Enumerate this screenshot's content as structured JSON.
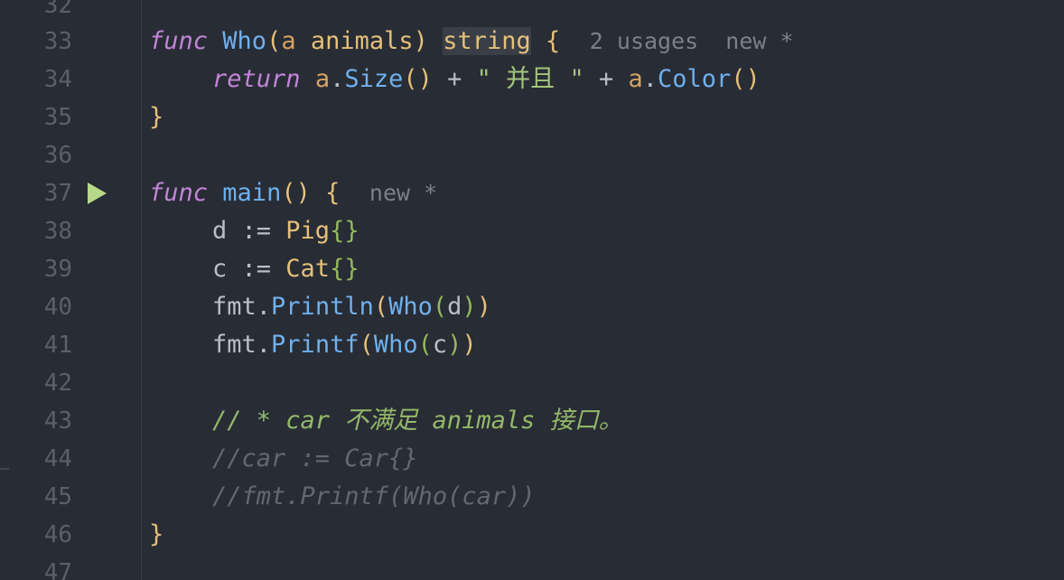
{
  "line_numbers": [
    "32",
    "33",
    "34",
    "35",
    "36",
    "37",
    "38",
    "39",
    "40",
    "41",
    "42",
    "43",
    "44",
    "45",
    "46",
    "47"
  ],
  "code": {
    "l33": {
      "kw": "func",
      "name": "Who",
      "open": "(",
      "param": "a",
      "ptype": "animals",
      "close": ")",
      "ret": "string",
      "brace": "{",
      "hint": "2 usages  new *"
    },
    "l34": {
      "kw": "return",
      "p1": "a",
      "dot1": ".",
      "m1": "Size",
      "paren1": "()",
      "plus1": " + ",
      "str": "\" 并且 \"",
      "plus2": " + ",
      "p2": "a",
      "dot2": ".",
      "m2": "Color",
      "paren2": "()"
    },
    "l35": {
      "brace": "}"
    },
    "l37": {
      "kw": "func",
      "name": "main",
      "paren": "()",
      "brace": "{",
      "hint": "new *"
    },
    "l38": {
      "var": "d",
      "op": " := ",
      "type": "Pig",
      "lit": "{}"
    },
    "l39": {
      "var": "c",
      "op": " := ",
      "type": "Cat",
      "lit": "{}"
    },
    "l40": {
      "pkg": "fmt",
      "dot": ".",
      "fn": "Println",
      "open1": "(",
      "inner": "Who",
      "open2": "(",
      "arg": "d",
      "close2": ")",
      "close1": ")"
    },
    "l41": {
      "pkg": "fmt",
      "dot": ".",
      "fn": "Printf",
      "open1": "(",
      "inner": "Who",
      "open2": "(",
      "arg": "c",
      "close2": ")",
      "close1": ")"
    },
    "l43": {
      "text": "// * car 不满足 animals 接口。"
    },
    "l44": {
      "text": "//car := Car{}"
    },
    "l45": {
      "text": "//fmt.Printf(Who(car))"
    },
    "l46": {
      "brace": "}"
    }
  }
}
